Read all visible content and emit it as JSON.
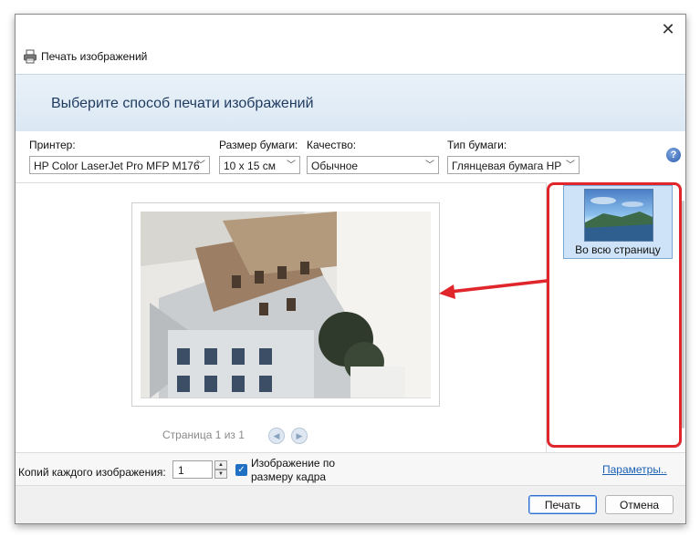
{
  "window": {
    "title": "Печать изображений",
    "close_glyph": "✕"
  },
  "header": {
    "heading": "Выберите способ печати изображений"
  },
  "settings": {
    "printer": {
      "label": "Принтер:",
      "value": "HP Color LaserJet Pro MFP M176"
    },
    "paper_size": {
      "label": "Размер бумаги:",
      "value": "10 x 15 см"
    },
    "quality": {
      "label": "Качество:",
      "value": "Обычное"
    },
    "paper_type": {
      "label": "Тип бумаги:",
      "value": "Глянцевая бумага HP"
    },
    "help_glyph": "?"
  },
  "preview": {
    "pager_text": "Страница 1 из 1",
    "prev_glyph": "◀",
    "next_glyph": "▶"
  },
  "layouts": {
    "items": [
      {
        "label": "Во всю страницу",
        "selected": true
      }
    ]
  },
  "options": {
    "copies_label": "Копий каждого изображения:",
    "copies_value": "1",
    "fit_label": "Изображение по размеру кадра",
    "fit_checked": true,
    "parameters_link": "Параметры.."
  },
  "buttons": {
    "print": "Печать",
    "cancel": "Отмена"
  },
  "colors": {
    "accent": "#1f6fc5",
    "highlight": "#e0252b",
    "link": "#1a5fb4"
  },
  "icons": {
    "app": "printer-icon",
    "help": "help-icon",
    "check": "checkmark-icon",
    "arrow": "red-arrow-annotation"
  }
}
